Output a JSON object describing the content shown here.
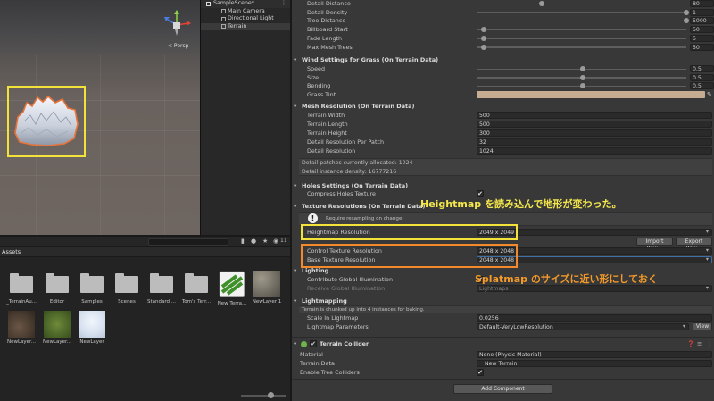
{
  "scene": {
    "persp_label": "< Persp",
    "gizmo_axes": [
      "y",
      "x",
      "z"
    ],
    "highlight_color": "#f2e23a"
  },
  "hierarchy": {
    "scene_name": "SampleScene*",
    "items": [
      {
        "label": "Main Camera"
      },
      {
        "label": "Directional Light"
      },
      {
        "label": "Terrain"
      }
    ]
  },
  "project": {
    "header": "Assets",
    "hidden_count": "11",
    "assets": [
      {
        "label": "_TerrainAu...",
        "kind": "folder"
      },
      {
        "label": "Editor",
        "kind": "folder"
      },
      {
        "label": "Samples",
        "kind": "folder"
      },
      {
        "label": "Scenes",
        "kind": "folder"
      },
      {
        "label": "Standard ...",
        "kind": "folder"
      },
      {
        "label": "Tom's Terr...",
        "kind": "folder"
      },
      {
        "label": "New Terra...",
        "kind": "terrain-data"
      },
      {
        "label": "NewLayer 1",
        "kind": "layer-rock"
      },
      {
        "label": "NewLayer...",
        "kind": "layer-dirt"
      },
      {
        "label": "NewLayer...",
        "kind": "layer-grass"
      },
      {
        "label": "NewLayer",
        "kind": "layer-snow"
      }
    ]
  },
  "inspector": {
    "tree_detail": [
      {
        "label": "Detail Distance",
        "value": "80",
        "fraction": 0.3
      },
      {
        "label": "Detail Density",
        "value": "1",
        "fraction": 1.0
      },
      {
        "label": "Tree Distance",
        "value": "5000",
        "fraction": 1.0
      },
      {
        "label": "Billboard Start",
        "value": "50",
        "fraction": 0.02
      },
      {
        "label": "Fade Length",
        "value": "5",
        "fraction": 0.02
      },
      {
        "label": "Max Mesh Trees",
        "value": "50",
        "fraction": 0.02
      }
    ],
    "wind": {
      "title": "Wind Settings for Grass (On Terrain Data)",
      "rows": [
        {
          "label": "Speed",
          "value": "0.5",
          "fraction": 0.5
        },
        {
          "label": "Size",
          "value": "0.5",
          "fraction": 0.5
        },
        {
          "label": "Bending",
          "value": "0.5",
          "fraction": 0.5
        }
      ],
      "grass_tint_label": "Grass Tint",
      "grass_tint_color": "#c6ad91"
    },
    "mesh": {
      "title": "Mesh Resolution (On Terrain Data)",
      "rows": [
        {
          "label": "Terrain Width",
          "value": "500"
        },
        {
          "label": "Terrain Length",
          "value": "500"
        },
        {
          "label": "Terrain Height",
          "value": "300"
        },
        {
          "label": "Detail Resolution Per Patch",
          "value": "32"
        },
        {
          "label": "Detail Resolution",
          "value": "1024"
        }
      ],
      "info_lines": [
        "Detail patches currently allocated: 1024",
        "Detail instance density: 16777216"
      ]
    },
    "holes": {
      "title": "Holes Settings (On Terrain Data)",
      "compress_label": "Compress Holes Texture",
      "compress_checked": "✔"
    },
    "texres": {
      "title": "Texture Resolutions (On Terrain Data)",
      "warning": "Require resampling on change",
      "heightmap_label": "Heightmap Resolution",
      "heightmap_value": "2049 x 2049",
      "import_label": "Import Raw...",
      "export_label": "Export Raw...",
      "control_label": "Control Texture Resolution",
      "control_value": "2048 x 2048",
      "base_label": "Base Texture Resolution",
      "base_value": "2048 x 2048"
    },
    "lighting": {
      "title": "Lighting",
      "contribute_label": "Contribute Global Illumination",
      "contribute_checked": "✔",
      "receive_label": "Receive Global Illumination",
      "receive_value": "Lightmaps"
    },
    "lightmapping": {
      "title": "Lightmapping",
      "info": "Terrain is chunked up into 4 instances for baking.",
      "scale_label": "Scale In Lightmap",
      "scale_value": "0.0256",
      "params_label": "Lightmap Parameters",
      "params_value": "Default-VeryLowResolution",
      "view_label": "View"
    },
    "collider": {
      "title": "Terrain Collider",
      "material_label": "Material",
      "material_value": "None (Physic Material)",
      "data_label": "Terrain Data",
      "data_value": "New Terrain",
      "trees_label": "Enable Tree Colliders",
      "trees_checked": "✔"
    },
    "add_component_label": "Add Component"
  },
  "annotations": {
    "heightmap_note": "Heightmap を読み込んで地形が変わった。",
    "splatmap_note": "Splatmap のサイズに近い形にしておく",
    "yellow": "#f2e23a",
    "orange": "#f08a2c"
  }
}
